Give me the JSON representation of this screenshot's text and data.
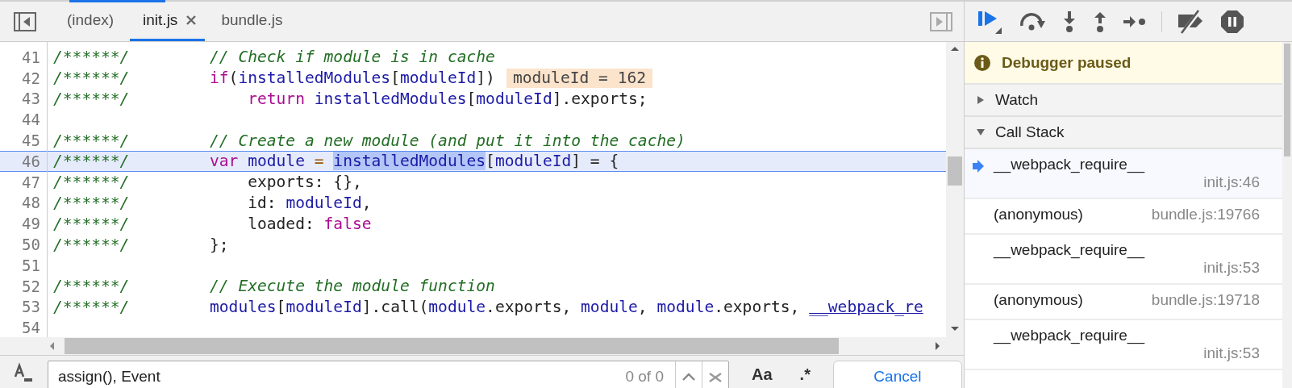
{
  "tabs": [
    {
      "label": "(index)",
      "selected": false,
      "closable": false
    },
    {
      "label": "init.js",
      "selected": true,
      "closable": true
    },
    {
      "label": "bundle.js",
      "selected": false,
      "closable": false
    }
  ],
  "lines": [
    {
      "number": "41",
      "prefix": "/******/",
      "current": false,
      "tokens": [
        {
          "kind": "comment",
          "text": "// Check if module is in cache"
        }
      ]
    },
    {
      "number": "42",
      "prefix": "/******/",
      "current": false,
      "tokens": [
        {
          "kind": "keyword",
          "text": "if"
        },
        {
          "kind": "plain",
          "text": "("
        },
        {
          "kind": "variable",
          "text": "installedModules"
        },
        {
          "kind": "plain",
          "text": "["
        },
        {
          "kind": "variable",
          "text": "moduleId"
        },
        {
          "kind": "plain",
          "text": "])"
        }
      ],
      "inline_value": "moduleId = 162"
    },
    {
      "number": "43",
      "prefix": "/******/",
      "current": false,
      "tokens": [
        {
          "kind": "keyword",
          "text": "    return "
        },
        {
          "kind": "variable",
          "text": "installedModules"
        },
        {
          "kind": "plain",
          "text": "["
        },
        {
          "kind": "variable",
          "text": "moduleId"
        },
        {
          "kind": "plain",
          "text": "].exports;"
        }
      ]
    },
    {
      "number": "44",
      "current": false
    },
    {
      "number": "45",
      "prefix": "/******/",
      "current": false,
      "tokens": [
        {
          "kind": "comment",
          "text": "// Create a new module (and put it into the cache)"
        }
      ]
    },
    {
      "number": "46",
      "prefix": "/******/",
      "current": true,
      "tokens": [
        {
          "kind": "keyword",
          "text": "var "
        },
        {
          "kind": "variable",
          "text": "module "
        },
        {
          "kind": "operator",
          "text": "= "
        },
        {
          "kind": "selection",
          "text": "installedModules"
        },
        {
          "kind": "plain",
          "text": "["
        },
        {
          "kind": "variable",
          "text": "moduleId"
        },
        {
          "kind": "plain",
          "text": "] = {"
        }
      ]
    },
    {
      "number": "47",
      "prefix": "/******/",
      "current": false,
      "tokens": [
        {
          "kind": "plain",
          "text": "    exports: {},"
        }
      ]
    },
    {
      "number": "48",
      "prefix": "/******/",
      "current": false,
      "tokens": [
        {
          "kind": "plain",
          "text": "    id: "
        },
        {
          "kind": "variable",
          "text": "moduleId"
        },
        {
          "kind": "plain",
          "text": ","
        }
      ]
    },
    {
      "number": "49",
      "prefix": "/******/",
      "current": false,
      "tokens": [
        {
          "kind": "plain",
          "text": "    loaded: "
        },
        {
          "kind": "keyword",
          "text": "false"
        }
      ]
    },
    {
      "number": "50",
      "prefix": "/******/",
      "current": false,
      "tokens": [
        {
          "kind": "plain",
          "text": "};"
        }
      ]
    },
    {
      "number": "51",
      "current": false
    },
    {
      "number": "52",
      "prefix": "/******/",
      "current": false,
      "tokens": [
        {
          "kind": "comment",
          "text": "// Execute the module function"
        }
      ]
    },
    {
      "number": "53",
      "prefix": "/******/",
      "current": false,
      "tokens": [
        {
          "kind": "variable",
          "text": "modules"
        },
        {
          "kind": "plain",
          "text": "["
        },
        {
          "kind": "variable",
          "text": "moduleId"
        },
        {
          "kind": "plain",
          "text": "].call("
        },
        {
          "kind": "variable",
          "text": "module"
        },
        {
          "kind": "plain",
          "text": ".exports, "
        },
        {
          "kind": "variable",
          "text": "module"
        },
        {
          "kind": "plain",
          "text": ", "
        },
        {
          "kind": "variable",
          "text": "module"
        },
        {
          "kind": "plain",
          "text": ".exports, "
        },
        {
          "kind": "link",
          "text": "__webpack_re"
        }
      ]
    },
    {
      "number": "54",
      "current": false
    }
  ],
  "debugger": {
    "status": "Debugger paused"
  },
  "sections": [
    {
      "title": "Watch",
      "expanded": false
    },
    {
      "title": "Call Stack",
      "expanded": true
    }
  ],
  "call_stack": [
    {
      "name": "__webpack_require__",
      "location": "init.js:46",
      "selected": true
    },
    {
      "name": "(anonymous)",
      "location": "bundle.js:19766",
      "selected": false
    },
    {
      "name": "__webpack_require__",
      "location": "init.js:53",
      "selected": false
    },
    {
      "name": "(anonymous)",
      "location": "bundle.js:19718",
      "selected": false
    },
    {
      "name": "__webpack_require__",
      "location": "init.js:53",
      "selected": false
    }
  ],
  "search": {
    "value": "assign(), Event",
    "count": "0 of 0",
    "match_case": "Aa",
    "regex": ".*",
    "cancel": "Cancel"
  }
}
